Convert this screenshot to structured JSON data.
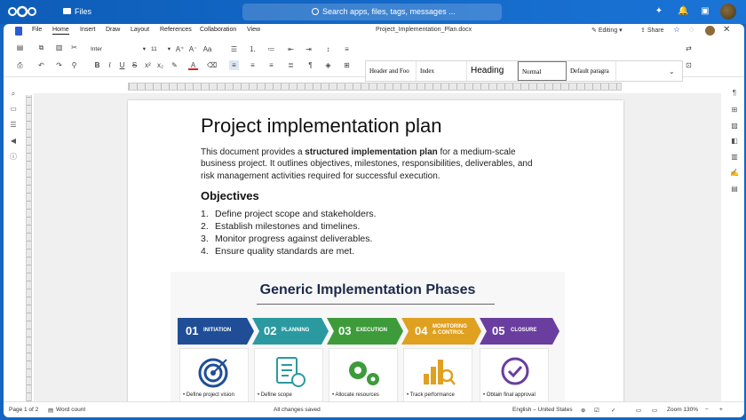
{
  "topbar": {
    "app_label": "Files",
    "search_placeholder": "Search apps, files, tags, messages ..."
  },
  "menubar": {
    "items": [
      "File",
      "Home",
      "Insert",
      "Draw",
      "Layout",
      "References",
      "Collaboration",
      "View"
    ],
    "active": "Home",
    "doc_title": "Project_Implementation_Plan.docx",
    "editing_label": "Editing",
    "share_label": "Share"
  },
  "toolbar": {
    "font": "Inter",
    "size": "11",
    "styles": [
      "Header and Foo",
      "Index",
      "Heading",
      "Normal",
      "Default paragra"
    ]
  },
  "document": {
    "title": "Project implementation plan",
    "intro_pre": "This document provides a ",
    "intro_bold": "structured implementation plan",
    "intro_post": " for a medium-scale business project. It outlines objectives, milestones, responsibilities, deliverables, and risk management activities required for successful execution.",
    "objectives_heading": "Objectives",
    "objectives": [
      {
        "num": "1.",
        "text": "Define project scope and stakeholders."
      },
      {
        "num": "2.",
        "text": "Establish milestones and timelines."
      },
      {
        "num": "3.",
        "text": "Monitor progress against deliverables."
      },
      {
        "num": "4.",
        "text": "Ensure quality standards are met."
      }
    ]
  },
  "infographic": {
    "title": "Generic Implementation Phases",
    "phases": [
      {
        "num": "01",
        "label": "INITIATION",
        "color": "#1f4e96",
        "bullet": "Define project vision"
      },
      {
        "num": "02",
        "label": "PLANNING",
        "color": "#2a9aa0",
        "bullet": "Define scope"
      },
      {
        "num": "03",
        "label": "EXECUTION",
        "color": "#3d9b3a",
        "bullet": "Allocate resources"
      },
      {
        "num": "04",
        "label": "MONITORING & CONTROL",
        "color": "#e0a020",
        "bullet": "Track performance"
      },
      {
        "num": "05",
        "label": "CLOSURE",
        "color": "#6a3e9e",
        "bullet": "Obtain final approval"
      }
    ]
  },
  "statusbar": {
    "page": "Page 1 of 2",
    "word_count": "Word count",
    "save_status": "All changes saved",
    "language": "English – United States",
    "zoom": "Zoom 130%"
  }
}
